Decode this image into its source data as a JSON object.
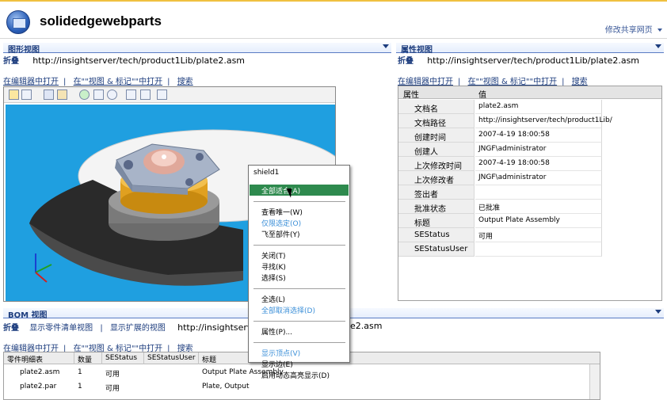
{
  "header": {
    "site_title": "solidedgewebparts",
    "modify_link": "修改共享网页"
  },
  "graphic_view": {
    "title": "图形视图",
    "refresh": "折叠",
    "url": "http://insightserver/tech/product1Lib/plate2.asm",
    "links": [
      "在编辑器中打开",
      "在\"\"视图 & 标记\"\"中打开",
      "搜索"
    ]
  },
  "property_view": {
    "title": "属性视图",
    "refresh": "折叠",
    "url": "http://insightserver/tech/product1Lib/plate2.asm",
    "links": [
      "在编辑器中打开",
      "在\"\"视图 & 标记\"\"中打开",
      "搜索"
    ],
    "columns": [
      "属性",
      "值"
    ],
    "rows": [
      {
        "k": "文档名",
        "v": "plate2.asm"
      },
      {
        "k": "文档路径",
        "v": "http://insightserver/tech/product1Lib/"
      },
      {
        "k": "创建时间",
        "v": "2007-4-19 18:00:58"
      },
      {
        "k": "创建人",
        "v": "JNGF\\administrator"
      },
      {
        "k": "上次修改时间",
        "v": "2007-4-19 18:00:58"
      },
      {
        "k": "上次修改者",
        "v": "JNGF\\administrator"
      },
      {
        "k": "签出者",
        "v": ""
      },
      {
        "k": "批准状态",
        "v": "已批准"
      },
      {
        "k": "标题",
        "v": "Output Plate Assembly"
      },
      {
        "k": "SEStatus",
        "v": "可用"
      },
      {
        "k": "SEStatusUser",
        "v": ""
      }
    ]
  },
  "bom_view": {
    "title": "BOM 视图",
    "refresh": "折叠",
    "show_parts": "显示零件清单视图",
    "show_expanded": "显示扩展的视图",
    "url_visible": "http://insightserv",
    "url_tail": "e2.asm",
    "links": [
      "在编辑器中打开",
      "在\"\"视图 & 标记\"\"中打开",
      "搜索"
    ],
    "columns": [
      "零件明细表",
      "数量",
      "SEStatus",
      "SEStatusUser",
      "标题"
    ],
    "rows": [
      {
        "name": "plate2.asm",
        "qty": "1",
        "status": "可用",
        "user": "",
        "title": "Output Plate Assembly"
      },
      {
        "name": "plate2.par",
        "qty": "1",
        "status": "可用",
        "user": "",
        "title": "Plate, Output"
      }
    ]
  },
  "context_menu": {
    "header": "shield1",
    "groups": [
      [
        {
          "label": "全部适合(A)",
          "state": "highlighted"
        }
      ],
      [
        {
          "label": "查看唯一(W)",
          "state": "normal"
        },
        {
          "label": "仅限选定(O)",
          "state": "disabled"
        },
        {
          "label": "飞至部件(Y)",
          "state": "normal"
        }
      ],
      [
        {
          "label": "关闭(T)",
          "state": "normal"
        },
        {
          "label": "寻找(K)",
          "state": "normal"
        },
        {
          "label": "选择(S)",
          "state": "normal"
        }
      ],
      [
        {
          "label": "全选(L)",
          "state": "normal"
        },
        {
          "label": "全部取消选择(D)",
          "state": "disabled"
        }
      ],
      [
        {
          "label": "属性(P)...",
          "state": "normal"
        }
      ],
      [
        {
          "label": "显示顶点(V)",
          "state": "disabled"
        },
        {
          "label": "显示边(E)",
          "state": "normal"
        },
        {
          "label": "启用动态高亮显示(D)",
          "state": "normal"
        }
      ]
    ]
  },
  "toolbar_icons": [
    "open-icon",
    "print-icon",
    "settings-icon",
    "camera-icon",
    "refresh-icon",
    "zoom-area-icon",
    "zoom-icon",
    "fit-icon",
    "pan-icon",
    "view-icon"
  ],
  "colors": {
    "viewport_bg": "#1f9fe0",
    "menu_highlight": "#2e8a4e",
    "title_blue": "#1d3d7e",
    "disabled_text": "#3b8fd8"
  }
}
